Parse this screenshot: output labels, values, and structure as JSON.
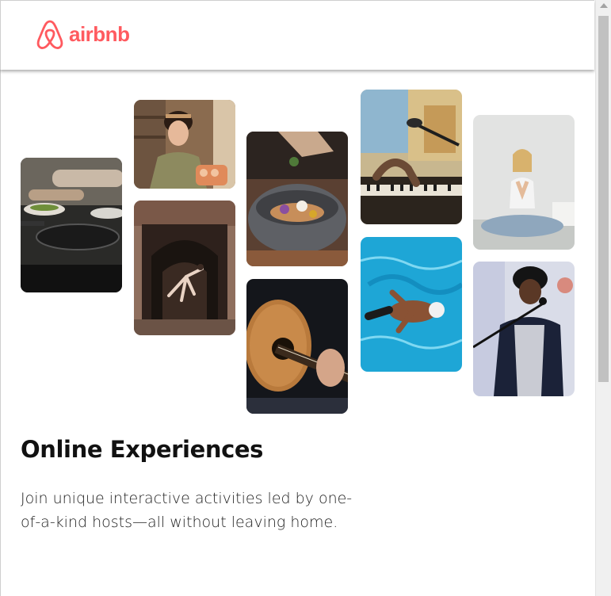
{
  "brand": {
    "name": "airbnb",
    "color": "#ff5a5f",
    "logo_icon": "airbnb-belo-icon"
  },
  "hero": {
    "title": "Online Experiences",
    "description": "Join unique interactive activities led by one-of-a-kind hosts—all without leaving home."
  },
  "gallery": [
    {
      "name": "cooking-pan-photo"
    },
    {
      "name": "baker-woman-photo"
    },
    {
      "name": "dancer-archway-photo"
    },
    {
      "name": "food-bowl-photo"
    },
    {
      "name": "guitar-photo"
    },
    {
      "name": "piano-microphone-photo"
    },
    {
      "name": "swimmer-pool-photo"
    },
    {
      "name": "yoga-woman-photo"
    },
    {
      "name": "singer-microphone-photo"
    }
  ]
}
